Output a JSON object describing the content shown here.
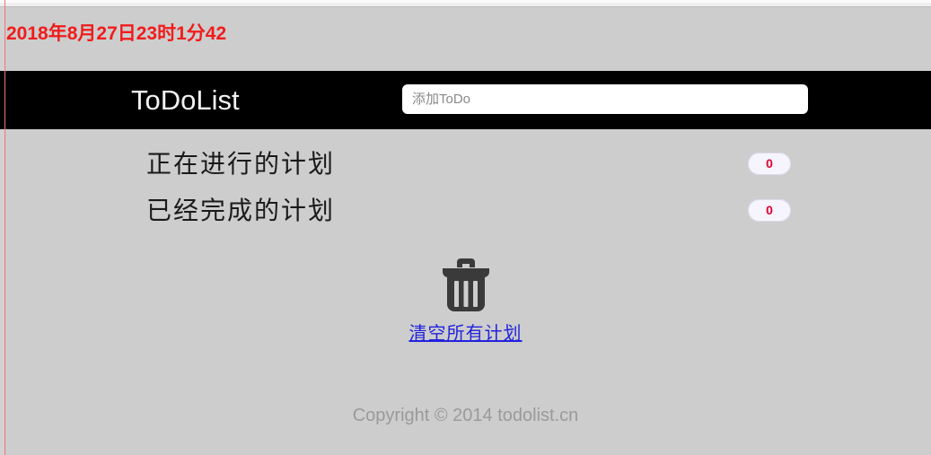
{
  "page": {
    "background_color": "#cdcdcd",
    "accent_rule_color": "#e8777c"
  },
  "clock": {
    "text": "2018年8月27日23时1分42",
    "color": "#f01c1c"
  },
  "header": {
    "title": "ToDoList",
    "title_color": "#f2f2f2",
    "bar_color": "#000000",
    "input": {
      "value": "",
      "placeholder": "添加ToDo",
      "name": "add-todo-input"
    }
  },
  "main": {
    "sections": [
      {
        "label": "正在进行的计划",
        "count": "0"
      },
      {
        "label": "已经完成的计划",
        "count": "0"
      }
    ],
    "badge_text_color": "#e00030",
    "badge_bg_color": "#f6f4fd"
  },
  "clear": {
    "icon": "trash-icon",
    "icon_color": "#3a3a3a",
    "link_label": "清空所有计划",
    "link_color": "#2222dd"
  },
  "footer": {
    "copyright": "Copyright © 2014 todolist.cn",
    "color": "#9a9a9a"
  }
}
